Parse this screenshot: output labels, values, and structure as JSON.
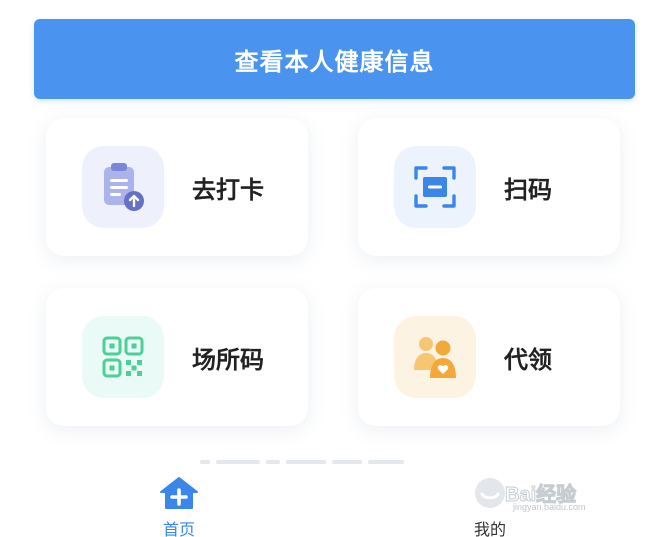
{
  "health_button": {
    "label": "查看本人健康信息"
  },
  "cards": {
    "checkin": {
      "label": "去打卡",
      "icon": "clipboard-upload-icon",
      "color": "#7a86d8"
    },
    "scan": {
      "label": "扫码",
      "icon": "scan-frame-icon",
      "color": "#3a86ea"
    },
    "place": {
      "label": "场所码",
      "icon": "qr-code-icon",
      "color": "#4ecf9a"
    },
    "proxy": {
      "label": "代领",
      "icon": "people-icon",
      "color": "#f2a93a"
    }
  },
  "tabbar": {
    "home": {
      "label": "首页",
      "icon": "home-plus-icon",
      "active": true
    },
    "mine": {
      "label": "我的",
      "icon": "profile-icon",
      "active": false
    }
  },
  "watermark": {
    "main": "Bai经验",
    "sub": "jingyan.baidu.com"
  },
  "colors": {
    "primary": "#4a93ee",
    "text": "#222222"
  }
}
